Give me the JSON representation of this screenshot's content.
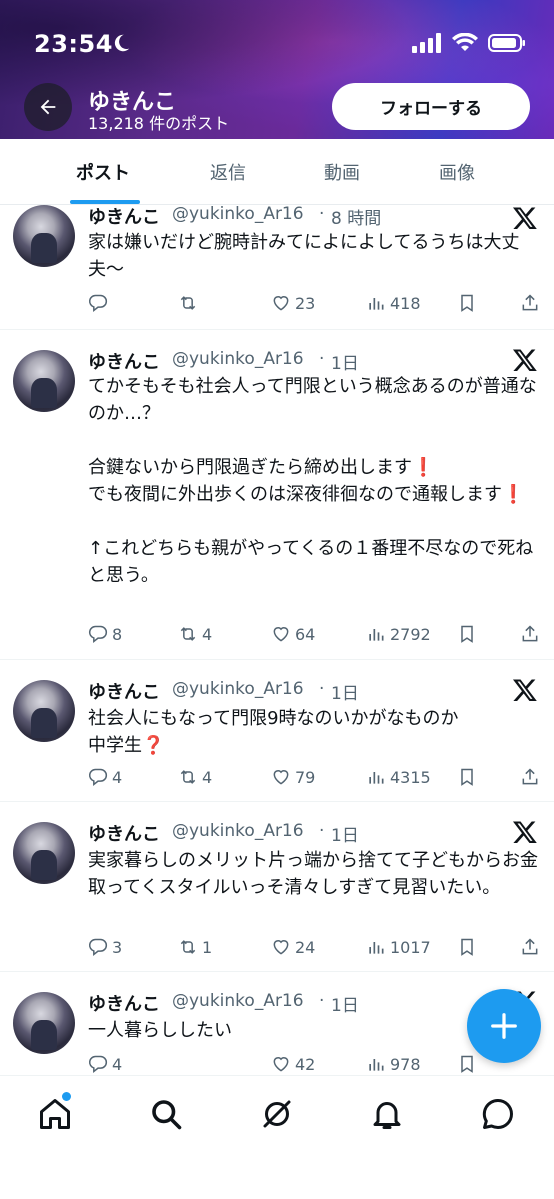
{
  "status": {
    "time": "23:54"
  },
  "profile": {
    "name": "ゆきんこ",
    "post_count": "13,218 件のポスト",
    "follow_label": "フォローする"
  },
  "tabs": [
    {
      "label": "ポスト",
      "active": true
    },
    {
      "label": "返信",
      "active": false
    },
    {
      "label": "動画",
      "active": false
    },
    {
      "label": "画像",
      "active": false
    }
  ],
  "posts": [
    {
      "name": "ゆきんこ",
      "handle": "@yukinko_Ar16",
      "time": "8 時間",
      "text": "家は嫌いだけど腕時計みてによによしてるうちは大丈夫〜",
      "replies": "",
      "reposts": "",
      "likes": "23",
      "views": "418"
    },
    {
      "name": "ゆきんこ",
      "handle": "@yukinko_Ar16",
      "time": "1日",
      "text": "てかそもそも社会人って門限という概念あるのが普通なのか…？\n\n合鍵ないから門限過ぎたら締め出します❗\nでも夜間に外出歩くのは深夜徘徊なので通報します❗\n\n↑これどちらも親がやってくるの１番理不尽なので死ねと思う。",
      "replies": "8",
      "reposts": "4",
      "likes": "64",
      "views": "2792"
    },
    {
      "name": "ゆきんこ",
      "handle": "@yukinko_Ar16",
      "time": "1日",
      "text": "社会人にもなって門限9時なのいかがなものか\n中学生❓",
      "replies": "4",
      "reposts": "4",
      "likes": "79",
      "views": "4315"
    },
    {
      "name": "ゆきんこ",
      "handle": "@yukinko_Ar16",
      "time": "1日",
      "text": "実家暮らしのメリット片っ端から捨てて子どもからお金取ってくスタイルいっそ清々しすぎて見習いたい。",
      "replies": "3",
      "reposts": "1",
      "likes": "24",
      "views": "1017"
    },
    {
      "name": "ゆきんこ",
      "handle": "@yukinko_Ar16",
      "time": "1日",
      "text": "一人暮らししたい",
      "replies": "4",
      "reposts": "",
      "likes": "42",
      "views": "978"
    }
  ],
  "icons": {
    "back": "back-arrow-icon",
    "compose": "plus-icon",
    "nav": [
      "home-icon",
      "search-icon",
      "grok-icon",
      "bell-icon",
      "message-icon"
    ]
  },
  "colors": {
    "accent": "#1d9bf0",
    "text": "#0f1419",
    "muted": "#536471"
  }
}
